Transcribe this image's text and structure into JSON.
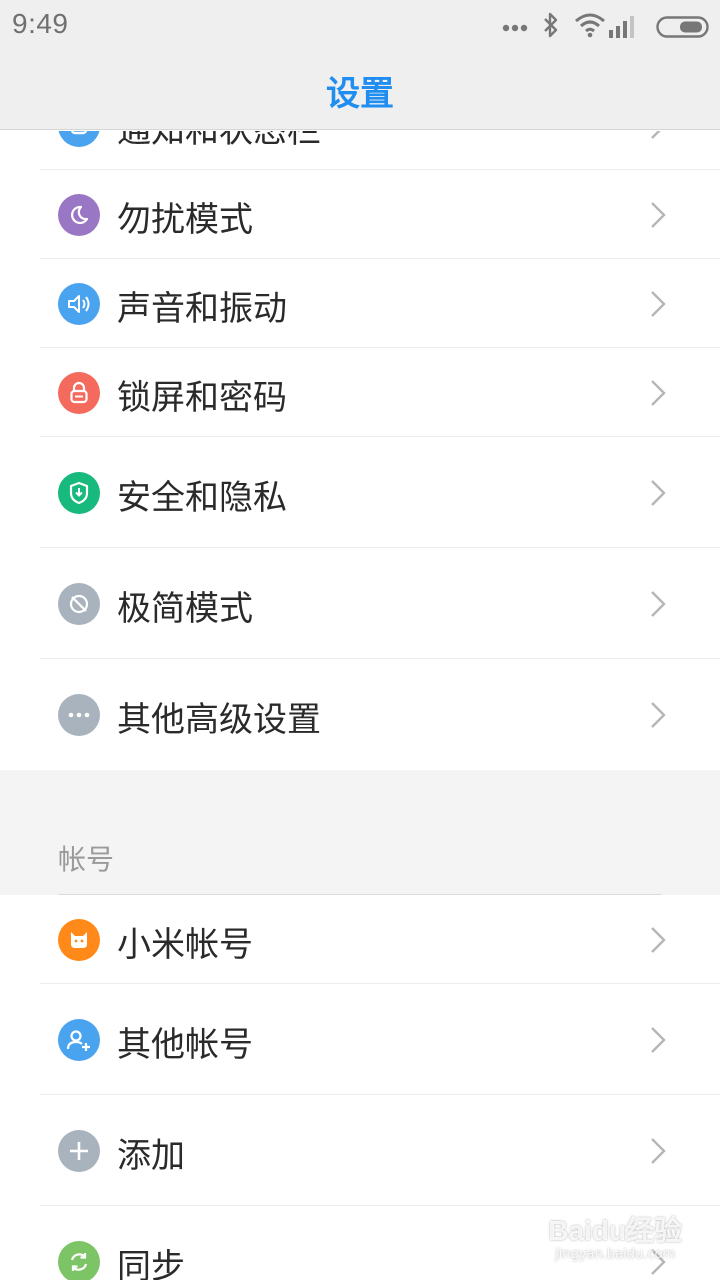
{
  "status_bar": {
    "time": "9:49",
    "icons": [
      "more-dots-icon",
      "bluetooth-icon",
      "wifi-icon",
      "signal-icon",
      "battery-icon"
    ]
  },
  "header": {
    "title": "设置"
  },
  "settings_items": [
    {
      "label": "通知和状态栏",
      "icon": "notification-icon",
      "color": "#4aa3ef"
    },
    {
      "label": "勿扰模式",
      "icon": "moon-icon",
      "color": "#9a77c5"
    },
    {
      "label": "声音和振动",
      "icon": "speaker-icon",
      "color": "#4aa3ef"
    },
    {
      "label": "锁屏和密码",
      "icon": "lock-icon",
      "color": "#f46b5e"
    },
    {
      "label": "安全和隐私",
      "icon": "shield-icon",
      "color": "#17b97d"
    },
    {
      "label": "极简模式",
      "icon": "minimal-mode-icon",
      "color": "#a9b3bd"
    },
    {
      "label": "其他高级设置",
      "icon": "more-icon",
      "color": "#a9b3bd"
    }
  ],
  "account_section": {
    "title": "帐号",
    "items": [
      {
        "label": "小米帐号",
        "icon": "mi-account-icon",
        "color": "#ff8a1a"
      },
      {
        "label": "其他帐号",
        "icon": "user-add-icon",
        "color": "#4aa3ef"
      },
      {
        "label": "添加",
        "icon": "plus-icon",
        "color": "#a9b3bd"
      },
      {
        "label": "同步",
        "icon": "sync-icon",
        "color": "#7cc465"
      }
    ]
  },
  "watermark": {
    "main": "Baidu经验",
    "sub": "jingyan.baidu.com"
  }
}
